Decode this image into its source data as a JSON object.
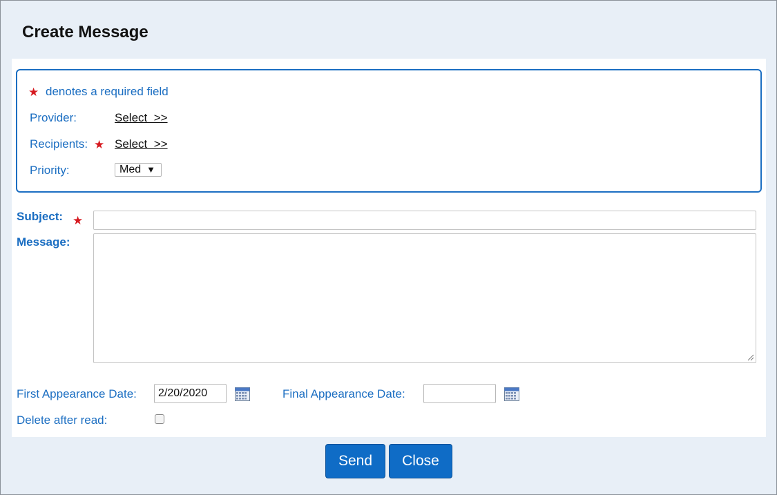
{
  "dialog": {
    "title": "Create Message"
  },
  "required_note": {
    "star": "★",
    "text": "denotes a required field"
  },
  "provider": {
    "label": "Provider:",
    "link": "Select  >>"
  },
  "recipients": {
    "label": "Recipients:",
    "star": "★",
    "link": "Select  >>"
  },
  "priority": {
    "label": "Priority:",
    "value": "Med",
    "arrow": "▼"
  },
  "subject": {
    "label": "Subject:",
    "star": "★",
    "value": ""
  },
  "message": {
    "label": "Message:",
    "value": ""
  },
  "first_date": {
    "label": "First Appearance Date:",
    "value": "2/20/2020",
    "icon": "calendar-icon"
  },
  "final_date": {
    "label": "Final Appearance Date:",
    "value": "",
    "icon": "calendar-icon"
  },
  "delete_after_read": {
    "label": "Delete after read:",
    "checked": false
  },
  "buttons": {
    "send": "Send",
    "close": "Close"
  },
  "colors": {
    "accent": "#1b6ec2",
    "required": "#d6191f",
    "button": "#0f6cc6",
    "background": "#e8eff7"
  }
}
